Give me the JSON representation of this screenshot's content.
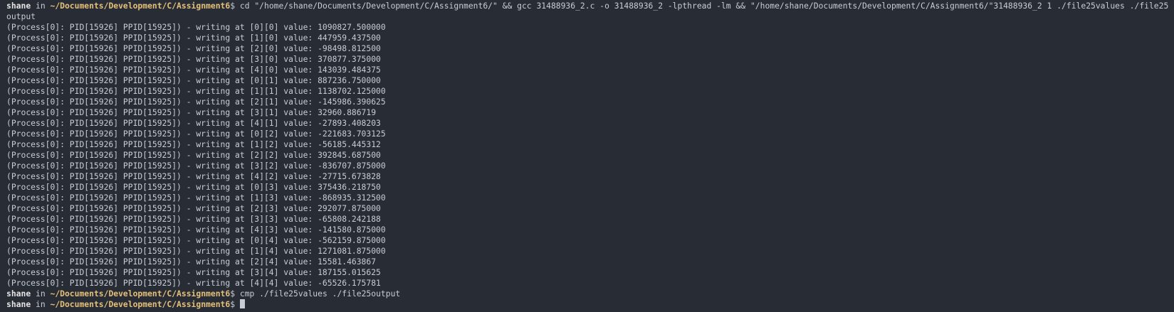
{
  "prompt": {
    "user": "shane",
    "in_word": " in ",
    "path": "~/Documents/Development/C/Assignment6",
    "dollar": "$ "
  },
  "first_command": "cd \"/home/shane/Documents/Development/C/Assignment6/\" && gcc 31488936_2.c -o 31488936_2 -lpthread -lm && \"/home/shane/Documents/Development/C/Assignment6/\"31488936_2 1 ./file25values ./file25output",
  "output_lines": [
    "(Process[0]: PID[15926] PPID[15925]) - writing at [0][0] value: 1090827.500000",
    "(Process[0]: PID[15926] PPID[15925]) - writing at [1][0] value: 447959.437500",
    "(Process[0]: PID[15926] PPID[15925]) - writing at [2][0] value: -98498.812500",
    "(Process[0]: PID[15926] PPID[15925]) - writing at [3][0] value: 370877.375000",
    "(Process[0]: PID[15926] PPID[15925]) - writing at [4][0] value: 143039.484375",
    "(Process[0]: PID[15926] PPID[15925]) - writing at [0][1] value: 887236.750000",
    "(Process[0]: PID[15926] PPID[15925]) - writing at [1][1] value: 1138702.125000",
    "(Process[0]: PID[15926] PPID[15925]) - writing at [2][1] value: -145986.390625",
    "(Process[0]: PID[15926] PPID[15925]) - writing at [3][1] value: 32960.886719",
    "(Process[0]: PID[15926] PPID[15925]) - writing at [4][1] value: -27893.408203",
    "(Process[0]: PID[15926] PPID[15925]) - writing at [0][2] value: -221683.703125",
    "(Process[0]: PID[15926] PPID[15925]) - writing at [1][2] value: -56185.445312",
    "(Process[0]: PID[15926] PPID[15925]) - writing at [2][2] value: 392845.687500",
    "(Process[0]: PID[15926] PPID[15925]) - writing at [3][2] value: -836707.875000",
    "(Process[0]: PID[15926] PPID[15925]) - writing at [4][2] value: -27715.673828",
    "(Process[0]: PID[15926] PPID[15925]) - writing at [0][3] value: 375436.218750",
    "(Process[0]: PID[15926] PPID[15925]) - writing at [1][3] value: -868935.312500",
    "(Process[0]: PID[15926] PPID[15925]) - writing at [2][3] value: 292077.875000",
    "(Process[0]: PID[15926] PPID[15925]) - writing at [3][3] value: -65808.242188",
    "(Process[0]: PID[15926] PPID[15925]) - writing at [4][3] value: -141580.875000",
    "(Process[0]: PID[15926] PPID[15925]) - writing at [0][4] value: -562159.875000",
    "(Process[0]: PID[15926] PPID[15925]) - writing at [1][4] value: 1271081.875000",
    "(Process[0]: PID[15926] PPID[15925]) - writing at [2][4] value: 15581.463867",
    "(Process[0]: PID[15926] PPID[15925]) - writing at [3][4] value: 187155.015625",
    "(Process[0]: PID[15926] PPID[15925]) - writing at [4][4] value: -65526.175781"
  ],
  "second_command": "cmp ./file25values ./file25output",
  "colors": {
    "background": "#282c34",
    "text": "#c8ccd4",
    "path": "#e5c07b"
  }
}
